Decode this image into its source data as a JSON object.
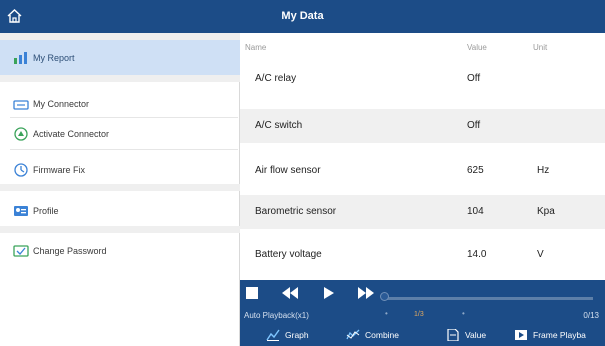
{
  "header": {
    "title": "My Data"
  },
  "sidebar": {
    "items": [
      {
        "label": "My Report",
        "icon": "report-icon"
      },
      {
        "label": "My Connector",
        "icon": "connector-icon"
      },
      {
        "label": "Activate Connector",
        "icon": "activate-icon"
      },
      {
        "label": "Firmware Fix",
        "icon": "firmware-icon"
      },
      {
        "label": "Profile",
        "icon": "profile-icon"
      },
      {
        "label": "Change Password",
        "icon": "password-icon"
      }
    ]
  },
  "table": {
    "columns": [
      "Name",
      "Value",
      "Unit"
    ],
    "rows": [
      {
        "name": "A/C relay",
        "value": "Off",
        "unit": ""
      },
      {
        "name": "A/C switch",
        "value": "Off",
        "unit": ""
      },
      {
        "name": "Air flow sensor",
        "value": "625",
        "unit": "Hz"
      },
      {
        "name": "Barometric sensor",
        "value": "104",
        "unit": "Kpa"
      },
      {
        "name": "Battery voltage",
        "value": "14.0",
        "unit": "V"
      }
    ]
  },
  "player": {
    "auto_label": "Auto Playback(x1)",
    "page_label": "1/3",
    "count_label": "0/13",
    "progress": 0
  },
  "bottom": {
    "graph": "Graph",
    "combine": "Combine",
    "value": "Value",
    "frame": "Frame Playba"
  },
  "colors": {
    "bar": "#1c4c87",
    "active_item": "#cfe0f5",
    "accent_green": "#3aa35a",
    "accent_blue": "#3b82d6"
  }
}
